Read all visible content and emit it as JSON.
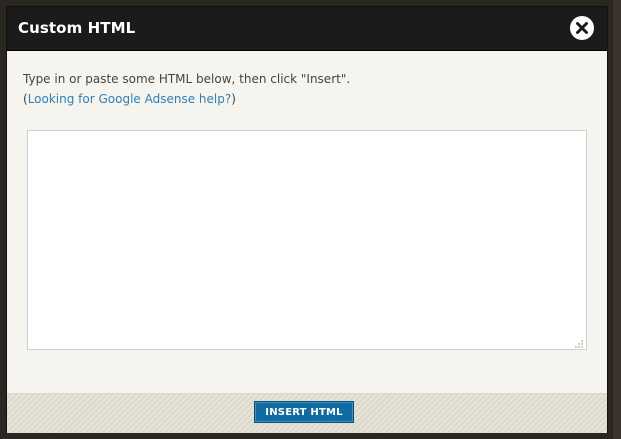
{
  "dialog": {
    "title": "Custom HTML",
    "close_icon": "close-icon"
  },
  "instructions": {
    "line1": "Type in or paste some HTML below, then click \"Insert\".",
    "paren_open": "(",
    "help_link": "Looking for Google Adsense help?",
    "paren_close": ")"
  },
  "editor": {
    "value": "",
    "placeholder": ""
  },
  "footer": {
    "insert_label": "INSERT HTML"
  },
  "colors": {
    "titlebar": "#1b1b1b",
    "link": "#2f7fb5",
    "button": "#0f6ba0",
    "dialog_bg": "#f6f4ef"
  }
}
